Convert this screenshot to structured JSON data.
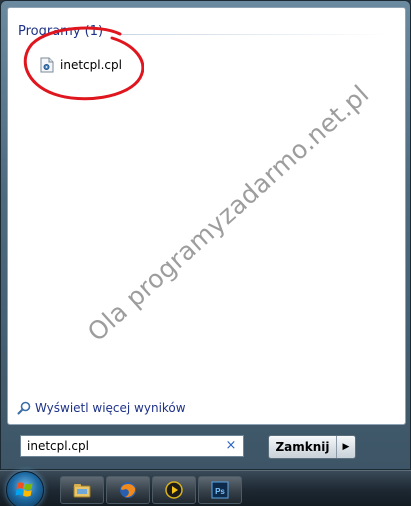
{
  "results": {
    "group_header": "Programy (1)",
    "items": [
      {
        "label": "inetcpl.cpl",
        "icon": "control-panel-file-icon"
      }
    ]
  },
  "watermark": "Ola programyzadarmo.net.pl",
  "more_results": "Wyświetl więcej wyników",
  "search": {
    "value": "inetcpl.cpl",
    "clear_glyph": "×"
  },
  "shutdown": {
    "label": "Zamknij",
    "arrow_glyph": "▶"
  },
  "taskbar": {
    "items": [
      {
        "name": "explorer-icon"
      },
      {
        "name": "firefox-icon"
      },
      {
        "name": "media-player-icon"
      },
      {
        "name": "photoshop-icon",
        "label": "Ps"
      }
    ]
  },
  "colors": {
    "link_blue": "#1e3287",
    "annotation_red": "#e0161f"
  }
}
